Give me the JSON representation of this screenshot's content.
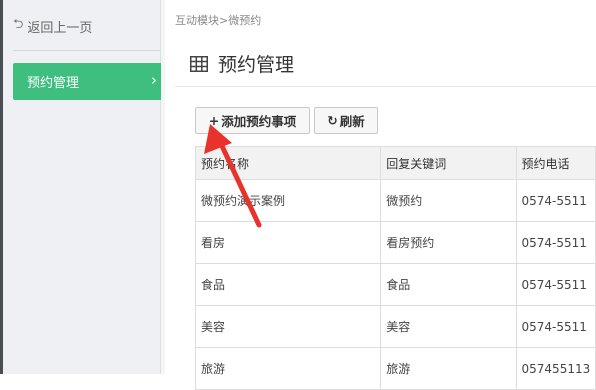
{
  "sidebar": {
    "back_label": "返回上一页",
    "active_item": "预约管理"
  },
  "main": {
    "breadcrumb": "互动模块>微预约",
    "page_title": "预约管理",
    "buttons": {
      "add_label": "添加预约事项",
      "refresh_label": "刷新"
    },
    "table": {
      "headers": [
        "预约名称",
        "回复关键词",
        "预约电话"
      ],
      "rows": [
        [
          "微预约演示案例",
          "微预约",
          "0574-5511"
        ],
        [
          "看房",
          "看房预约",
          "0574-5511"
        ],
        [
          "食品",
          "食品",
          "0574-5511"
        ],
        [
          "美容",
          "美容",
          "0574-5511"
        ],
        [
          "旅游",
          "旅游",
          "057455113"
        ]
      ]
    }
  },
  "colors": {
    "active_menu": "#3fbf7f",
    "annotation_arrow": "#e8322b"
  }
}
